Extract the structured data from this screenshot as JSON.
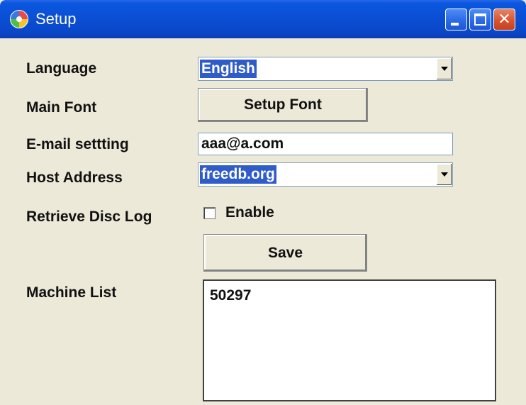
{
  "window": {
    "title": "Setup",
    "icon": "cd-disc-icon",
    "controls": [
      "minimize-icon",
      "maximize-icon",
      "close-icon"
    ],
    "close_glyph": "✕"
  },
  "form": {
    "language": {
      "label": "Language",
      "selected": "English"
    },
    "main_font": {
      "label": "Main Font",
      "button": "Setup Font"
    },
    "email": {
      "label": "E-mail settting",
      "value": "aaa@a.com"
    },
    "host": {
      "label": "Host Address",
      "selected": "freedb.org"
    },
    "disc_log": {
      "label": "Retrieve Disc Log",
      "checkbox_label": "Enable",
      "checked": false
    },
    "save_button": "Save",
    "machine_list": {
      "label": "Machine List",
      "items": [
        "50297"
      ]
    }
  },
  "colors": {
    "titlebar": "#0a50d6",
    "window_bg": "#ece9d8",
    "selection": "#2f5cc9",
    "close_button": "#d9532f"
  }
}
